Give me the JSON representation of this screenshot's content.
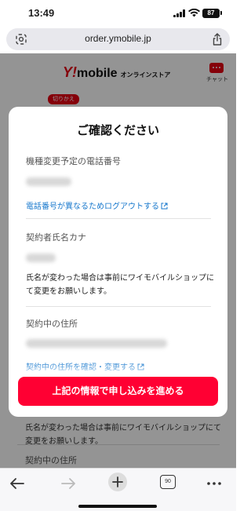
{
  "status_bar": {
    "time": "13:49",
    "battery": "87"
  },
  "browser": {
    "url": "order.ymobile.jp",
    "tab_count": "90"
  },
  "site": {
    "logo_brand": "Y!",
    "logo_name": "mobile",
    "logo_sub": "オンラインストア",
    "chat_label": "チャット",
    "switch_tab": "切りかえ"
  },
  "background": {
    "note": "氏名が変わった場合は事前にワイモバイルショップにて変更をお願いします。",
    "label": "契約中の住所"
  },
  "modal": {
    "title": "ご確認ください",
    "phone_label": "機種変更予定の電話番号",
    "logout_link": "電話番号が異なるためログアウトする",
    "name_label": "契約者氏名カナ",
    "name_note": "氏名が変わった場合は事前にワイモバイルショップにて変更をお願いします。",
    "address_label": "契約中の住所",
    "address_link": "契約中の住所を確認・変更する",
    "submit_button": "上記の情報で申し込みを進める"
  },
  "colors": {
    "accent": "#ff0033",
    "brand": "#e60012",
    "link": "#1677cc"
  }
}
